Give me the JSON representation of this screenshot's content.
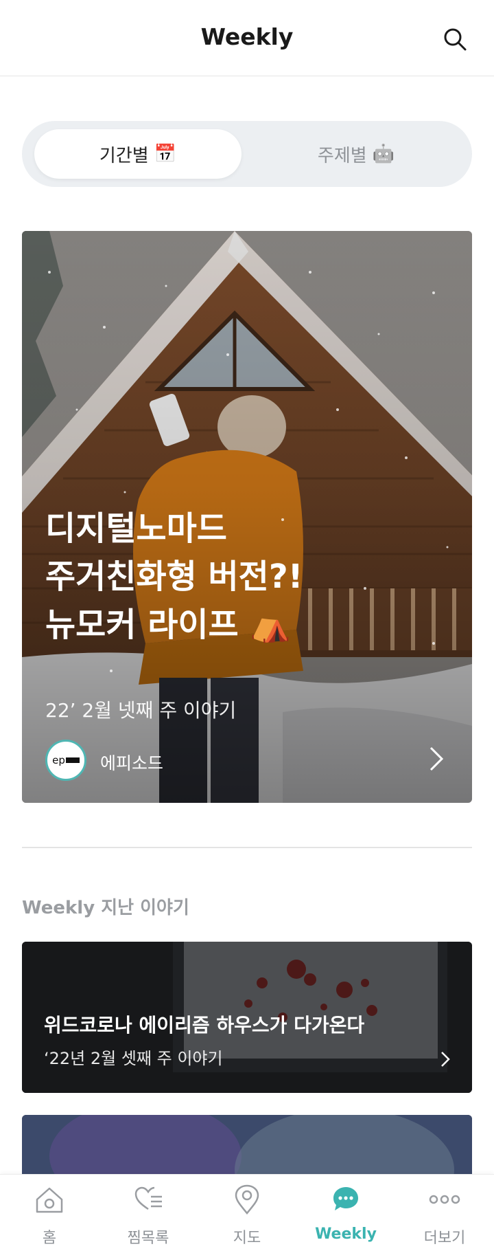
{
  "header": {
    "title": "Weekly",
    "search_icon": "search-icon"
  },
  "segment": {
    "tabs": [
      {
        "label": "기간별",
        "emoji": "📅",
        "active": true
      },
      {
        "label": "주제별",
        "emoji": "🤖",
        "active": false
      }
    ]
  },
  "hero": {
    "title": "디지털노마드\n주거친화형 버전?!\n뉴모커 라이프 ⛺",
    "subtitle": "22’ 2월 넷째 주 이야기",
    "source": "에피소드",
    "logo_text": "ep"
  },
  "past": {
    "section_title": "Weekly 지난 이야기",
    "stories": [
      {
        "title": "위드코로나 에이리즘 하우스가 다가온다",
        "subtitle": "‘22년 2월 셋째 주 이야기"
      }
    ]
  },
  "nav": {
    "items": [
      {
        "label": "홈",
        "icon": "home-icon"
      },
      {
        "label": "찜목록",
        "icon": "heart-list-icon"
      },
      {
        "label": "지도",
        "icon": "map-pin-icon"
      },
      {
        "label": "Weekly",
        "icon": "chat-bubble-icon",
        "active": true
      },
      {
        "label": "더보기",
        "icon": "more-icon"
      }
    ]
  },
  "colors": {
    "accent": "#3bb3b0",
    "segment_bg": "#eceff2",
    "muted_text": "#9a9da1"
  }
}
